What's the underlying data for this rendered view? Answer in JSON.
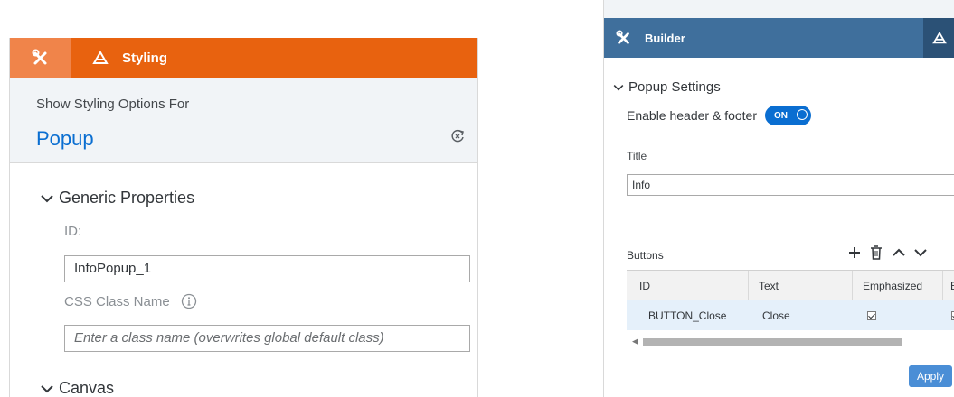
{
  "left_panel": {
    "tabs": {
      "builder_icon": "tools-icon",
      "styling_icon": "paint-brush-icon",
      "styling_label": "Styling"
    },
    "header": {
      "subtitle": "Show Styling Options For",
      "title": "Popup",
      "reset_icon": "reset-icon"
    },
    "generic_properties": {
      "section_title": "Generic Properties",
      "id_label": "ID:",
      "id_value": "InfoPopup_1",
      "css_label": "CSS Class Name",
      "css_placeholder": "Enter a class name (overwrites global default class)"
    },
    "canvas": {
      "section_title": "Canvas"
    }
  },
  "right_panel": {
    "tabs": {
      "builder_label": "Builder",
      "builder_icon": "tools-icon",
      "styling_icon": "paint-brush-icon"
    },
    "popup_settings": {
      "section_title": "Popup Settings",
      "toggle_label": "Enable header & footer",
      "toggle_state": "ON",
      "title_label": "Title",
      "title_value": "Info",
      "buttons_label": "Buttons",
      "toolbar_icons": [
        "add-icon",
        "delete-icon",
        "move-up-icon",
        "move-down-icon"
      ],
      "grid": {
        "columns": [
          "ID",
          "Text",
          "Emphasized",
          "E"
        ],
        "rows": [
          {
            "id": "BUTTON_Close",
            "text": "Close",
            "emphasized": true,
            "enabled": true
          }
        ]
      },
      "apply_label": "Apply"
    }
  },
  "colors": {
    "styling_orange": "#e8620f",
    "builder_blue": "#3f6f9c",
    "accent_blue": "#0a6ed1"
  }
}
